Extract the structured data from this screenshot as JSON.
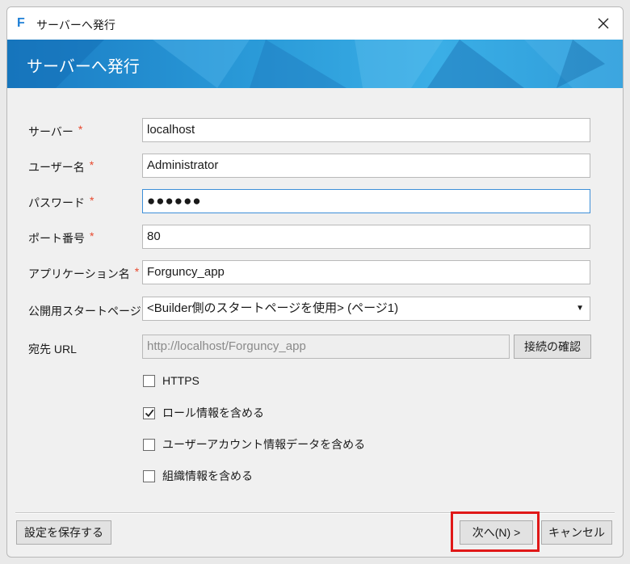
{
  "window": {
    "title": "サーバーへ発行",
    "app_icon_glyph": "F",
    "close_glyph": "✕"
  },
  "banner": {
    "title": "サーバーへ発行"
  },
  "required_mark": "*",
  "form": {
    "server": {
      "label": "サーバー",
      "value": "localhost"
    },
    "username": {
      "label": "ユーザー名",
      "value": "Administrator"
    },
    "password": {
      "label": "パスワード",
      "value": "●●●●●●"
    },
    "port": {
      "label": "ポート番号",
      "value": "80"
    },
    "app_name": {
      "label": "アプリケーション名",
      "value": "Forguncy_app"
    },
    "start_page": {
      "label": "公開用スタートページ",
      "value": "<Builder側のスタートページを使用> (ページ1)",
      "arrow": "▼"
    },
    "dest_url": {
      "label": "宛先 URL",
      "value": "http://localhost/Forguncy_app"
    },
    "check_connection_label": "接続の確認"
  },
  "checkboxes": [
    {
      "label": "HTTPS",
      "checked": false
    },
    {
      "label": "ロール情報を含める",
      "checked": true
    },
    {
      "label": "ユーザーアカウント情報データを含める",
      "checked": false
    },
    {
      "label": "組織情報を含める",
      "checked": false
    }
  ],
  "footer": {
    "save_label": "設定を保存する",
    "next_label": "次へ(N) >",
    "cancel_label": "キャンセル"
  },
  "colors": {
    "accent": "#1e7fd6",
    "required": "#e8492e",
    "highlight": "#e01818"
  }
}
